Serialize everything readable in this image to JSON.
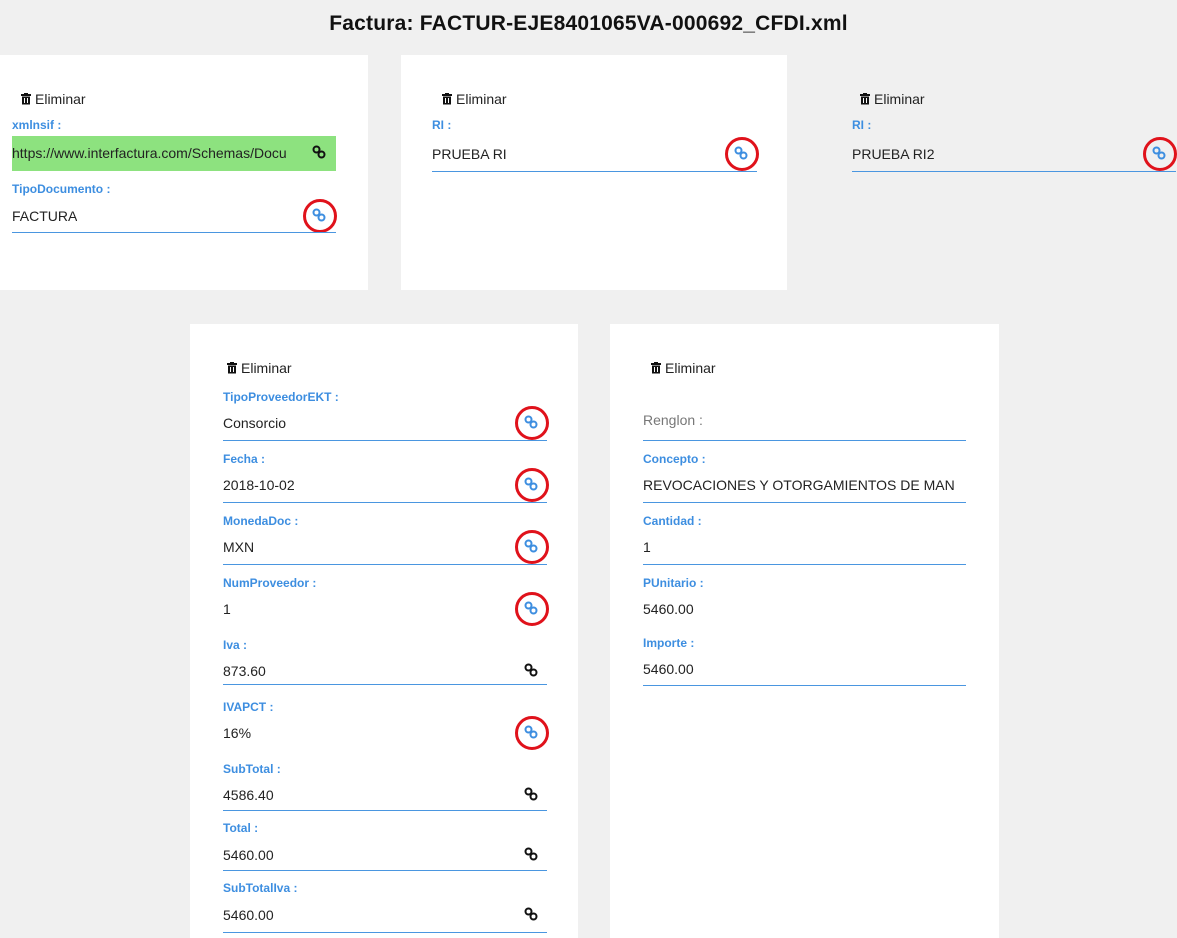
{
  "page": {
    "title": "Factura: FACTUR-EJE8401065VA-000692_CFDI.xml",
    "delete_label": "Eliminar"
  },
  "colors": {
    "label_blue": "#3d8ee0",
    "underline_blue": "#4a96e0",
    "highlight_green": "#8de27f",
    "annotation_red": "#e0121b"
  },
  "icons": {
    "delete": "trash-icon",
    "link": "link-icon"
  },
  "card1": {
    "fields": [
      {
        "label": "xmlnsif :",
        "value": "https://www.interfactura.com/Schemas/Docu"
      },
      {
        "label": "TipoDocumento :",
        "value": "FACTURA"
      }
    ]
  },
  "card2": {
    "fields": [
      {
        "label": "RI :",
        "value": "PRUEBA RI"
      }
    ]
  },
  "card3": {
    "fields": [
      {
        "label": "RI :",
        "value": "PRUEBA RI2"
      }
    ]
  },
  "card4": {
    "fields": [
      {
        "label": "TipoProveedorEKT :",
        "value": "Consorcio"
      },
      {
        "label": "Fecha :",
        "value": "2018-10-02"
      },
      {
        "label": "MonedaDoc :",
        "value": "MXN"
      },
      {
        "label": "NumProveedor :",
        "value": "1"
      },
      {
        "label": "Iva :",
        "value": "873.60"
      },
      {
        "label": "IVAPCT :",
        "value": "16%"
      },
      {
        "label": "SubTotal :",
        "value": "4586.40"
      },
      {
        "label": "Total :",
        "value": "5460.00"
      },
      {
        "label": "SubTotalIva :",
        "value": "5460.00"
      }
    ]
  },
  "card5": {
    "fields": [
      {
        "label": "Renglon :",
        "value": ""
      },
      {
        "label": "Concepto :",
        "value": "REVOCACIONES Y OTORGAMIENTOS DE MAN"
      },
      {
        "label": "Cantidad :",
        "value": "1"
      },
      {
        "label": "PUnitario :",
        "value": "5460.00"
      },
      {
        "label": "Importe :",
        "value": "5460.00"
      }
    ]
  }
}
